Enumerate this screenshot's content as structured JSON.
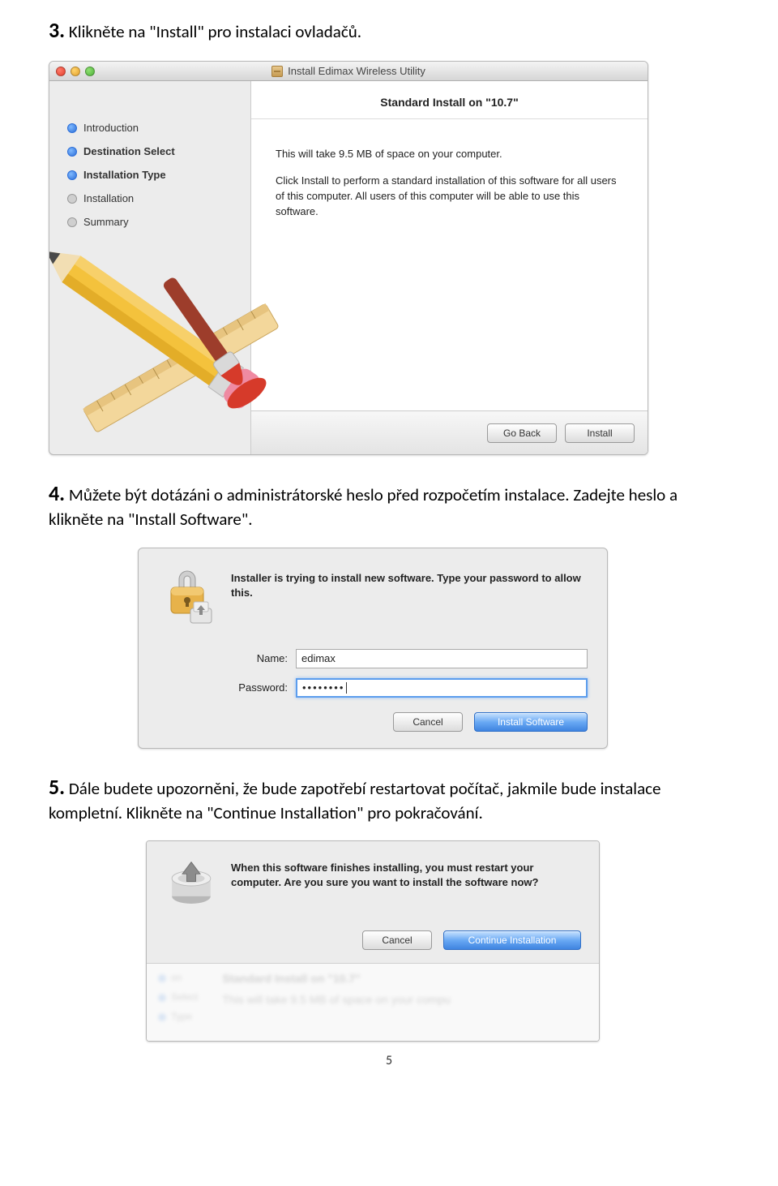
{
  "step3": {
    "num": "3.",
    "text": "Klikněte na \"Install\" pro instalaci ovladačů."
  },
  "shot1": {
    "title": "Install Edimax Wireless Utility",
    "heading": "Standard Install on \"10.7\"",
    "sidebar": [
      {
        "label": "Introduction",
        "done": true,
        "bold": false
      },
      {
        "label": "Destination Select",
        "done": true,
        "bold": true
      },
      {
        "label": "Installation Type",
        "done": true,
        "bold": true
      },
      {
        "label": "Installation",
        "done": false,
        "bold": false
      },
      {
        "label": "Summary",
        "done": false,
        "bold": false
      }
    ],
    "body1": "This will take 9.5 MB of space on your computer.",
    "body2": "Click Install to perform a standard installation of this software for all users of this computer. All users of this computer will be able to use this software.",
    "go_back": "Go Back",
    "install": "Install"
  },
  "step4": {
    "num": "4.",
    "text": "Můžete být dotázáni o administrátorské heslo před rozpočetím instalace. Zadejte heslo a klikněte na \"Install Software\"."
  },
  "shot2": {
    "msg": "Installer is trying to install new software. Type your password to allow this.",
    "name_label": "Name:",
    "name_value": "edimax",
    "pass_label": "Password:",
    "pass_value": "••••••••",
    "cancel": "Cancel",
    "install": "Install Software"
  },
  "step5": {
    "num": "5.",
    "text": "Dále budete upozorněni, že bude zapotřebí restartovat počítač, jakmile bude instalace kompletní. Klikněte na \"Continue Installation\" pro pokračování."
  },
  "shot3": {
    "msg": "When this software finishes installing, you must restart your computer. Are you sure you want to install the software now?",
    "cancel": "Cancel",
    "continue": "Continue Installation",
    "bg_heading": "Standard Install on \"10.7\"",
    "bg_body": "This will take 9.5 MB of space on your compu",
    "bg_items": [
      "on",
      "Select",
      "Type"
    ]
  },
  "page_num": "5"
}
